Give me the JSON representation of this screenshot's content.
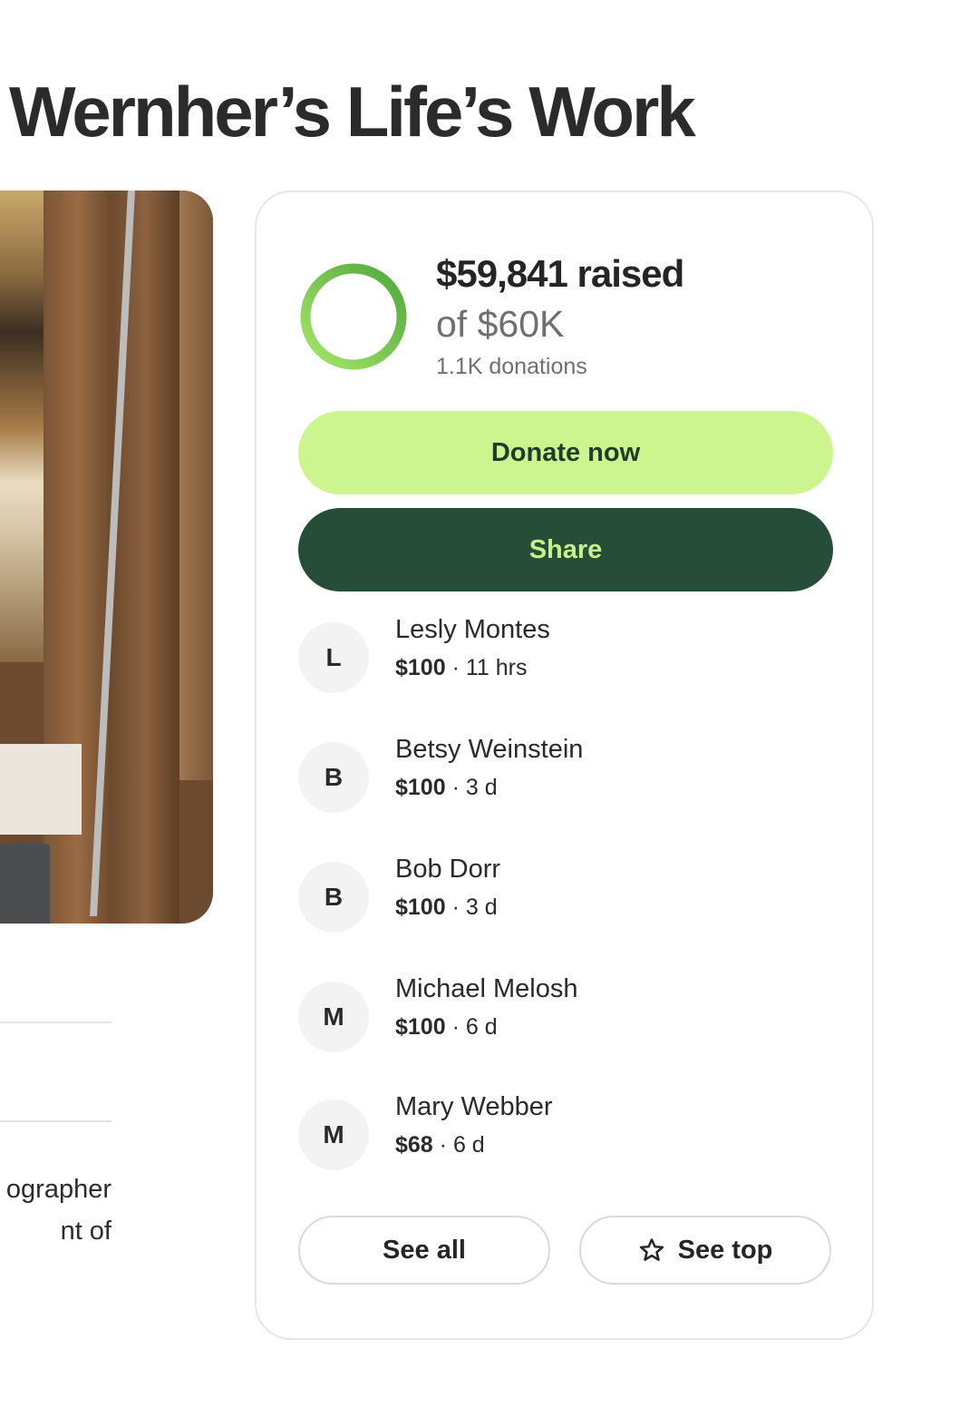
{
  "page": {
    "title": "Wernher’s Life’s Work"
  },
  "carousel": {
    "prev_icon": "arrow-left-icon",
    "next_icon": "arrow-right-icon"
  },
  "description": {
    "lines": [
      "ographer",
      "nt of"
    ]
  },
  "fundraiser": {
    "raised_text": "$59,841 raised",
    "goal_text": "of $60K",
    "donations_text": "1.1K donations",
    "progress_fraction": 0.997,
    "accent_color": "#5cb944",
    "donate_label": "Donate now",
    "share_label": "Share"
  },
  "donors": [
    {
      "initial": "L",
      "name": "Lesly Montes",
      "amount": "$100",
      "time": "11 hrs"
    },
    {
      "initial": "B",
      "name": "Betsy Weinstein",
      "amount": "$100",
      "time": "3 d"
    },
    {
      "initial": "B",
      "name": "Bob Dorr",
      "amount": "$100",
      "time": "3 d"
    },
    {
      "initial": "M",
      "name": "Michael Melosh",
      "amount": "$100",
      "time": "6 d"
    },
    {
      "initial": "M",
      "name": "Mary Webber",
      "amount": "$68",
      "time": "6 d"
    }
  ],
  "actions": {
    "see_all_label": "See all",
    "see_top_label": "See top",
    "see_top_icon": "star-icon"
  }
}
